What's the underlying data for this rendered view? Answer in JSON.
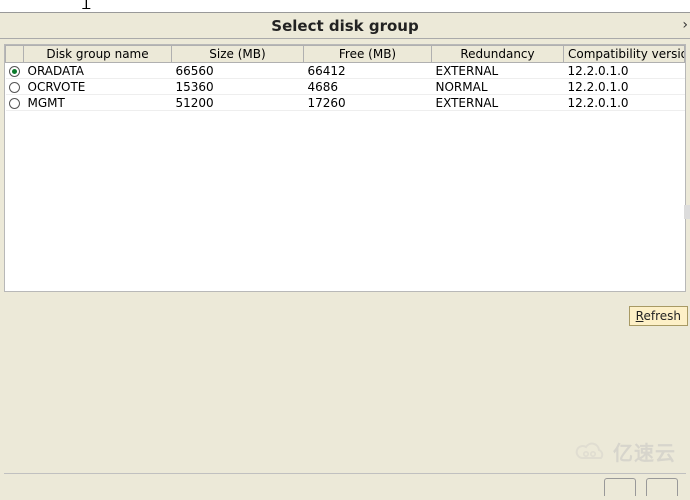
{
  "dialog": {
    "title": "Select disk group",
    "refresh_label": "Refresh"
  },
  "columns": {
    "name": "Disk group name",
    "size": "Size (MB)",
    "free": "Free (MB)",
    "redundancy": "Redundancy",
    "compat": "Compatibility versio"
  },
  "rows": [
    {
      "selected": true,
      "name": "ORADATA",
      "size": "66560",
      "free": "66412",
      "redundancy": "EXTERNAL",
      "compat": "12.2.0.1.0"
    },
    {
      "selected": false,
      "name": "OCRVOTE",
      "size": "15360",
      "free": "4686",
      "redundancy": "NORMAL",
      "compat": "12.2.0.1.0"
    },
    {
      "selected": false,
      "name": "MGMT",
      "size": "51200",
      "free": "17260",
      "redundancy": "EXTERNAL",
      "compat": "12.2.0.1.0"
    }
  ],
  "watermark": "亿速云"
}
